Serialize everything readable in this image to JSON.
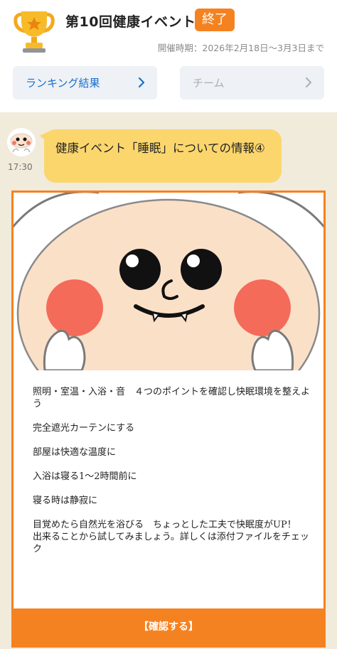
{
  "header": {
    "trophy_icon": "trophy-icon",
    "title": "第10回健康イベント",
    "status_badge": "終了",
    "period": "開催時期：2026年2月18日〜3月3日まで",
    "accent_color": "#f58220"
  },
  "nav": {
    "ranking_label": "ランキング結果",
    "team_label": "チーム",
    "chevron_icon": "chevron-right-icon"
  },
  "message": {
    "avatar_icon": "mascot-avatar",
    "time": "17:30",
    "bubble_text": "健康イベント「睡眠」についての情報④",
    "bubble_color": "#fbd66d"
  },
  "card": {
    "image": "mascot-illustration",
    "paragraphs": [
      "照明・室温・入浴・音　４つのポイントを確認し快眠環境を整えよう",
      "完全遮光カーテンにする",
      "部屋は快適な温度に",
      "入浴は寝る1〜2時間前に",
      "寝る時は静寂に",
      "目覚めたら自然光を浴びる　ちょっとした工夫で快眠度がUP！\n出来ることから試してみましょう。詳しくは添付ファイルをチェック"
    ],
    "confirm_label": "【確認する】"
  }
}
